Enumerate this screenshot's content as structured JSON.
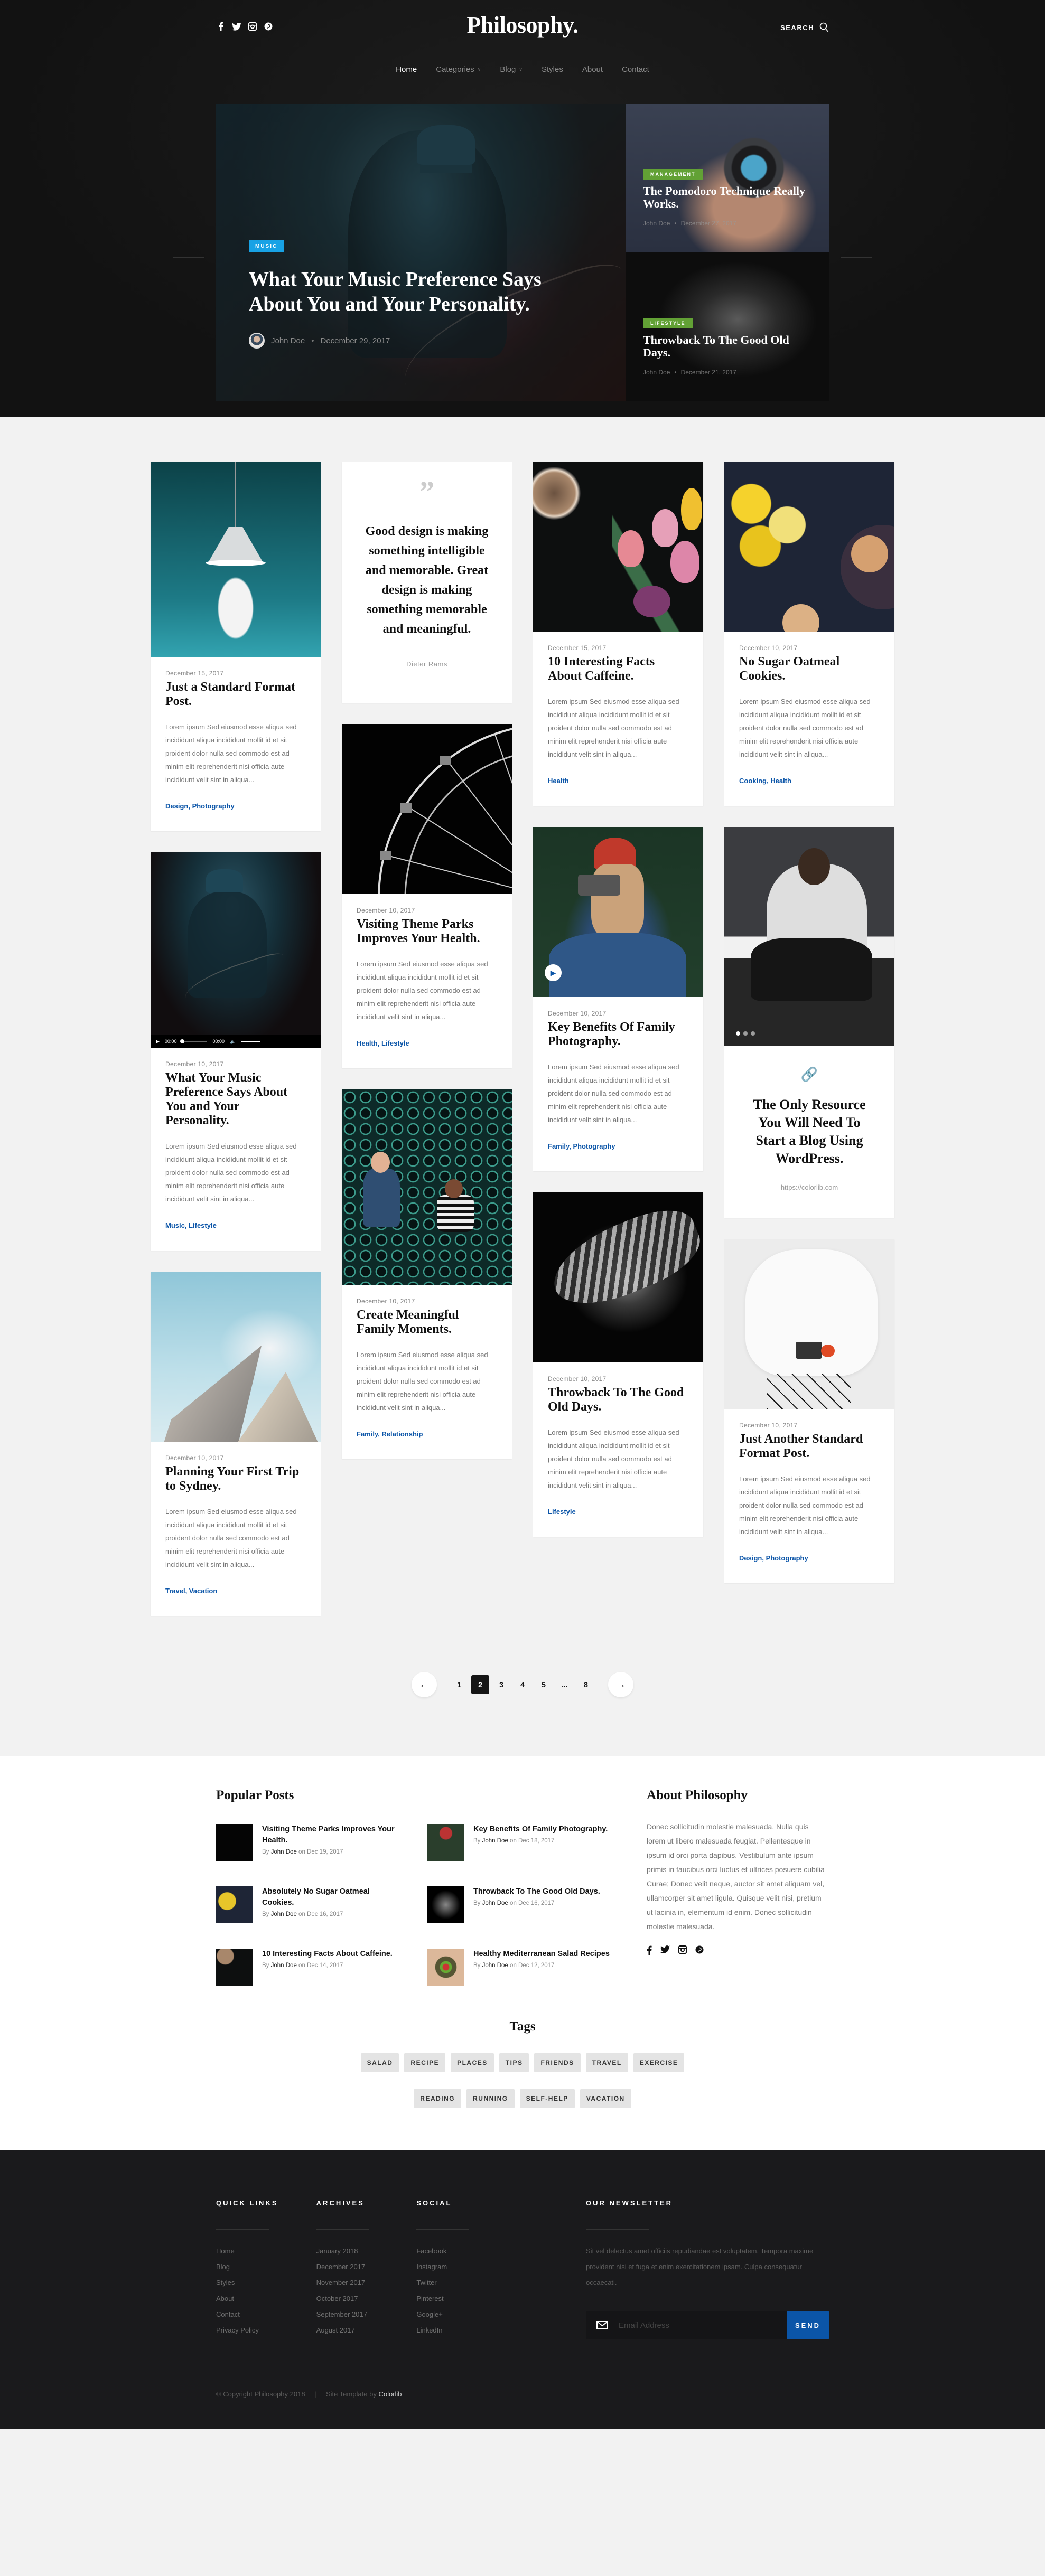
{
  "header": {
    "logo": "Philosophy.",
    "search_label": "SEARCH",
    "social": [
      "facebook-icon",
      "twitter-icon",
      "instagram-icon",
      "pinterest-icon"
    ],
    "nav": [
      {
        "label": "Home",
        "active": true,
        "dropdown": false
      },
      {
        "label": "Categories",
        "active": false,
        "dropdown": true
      },
      {
        "label": "Blog",
        "active": false,
        "dropdown": true
      },
      {
        "label": "Styles",
        "active": false,
        "dropdown": false
      },
      {
        "label": "About",
        "active": false,
        "dropdown": false
      },
      {
        "label": "Contact",
        "active": false,
        "dropdown": false
      }
    ]
  },
  "featured": {
    "main": {
      "category": "Music",
      "category_color": "#18a2e5",
      "title": "What Your Music Preference Says About You and Your Personality.",
      "author": "John Doe",
      "date": "December 29, 2017"
    },
    "side": [
      {
        "category": "Management",
        "category_color": "#62a135",
        "title": "The Pomodoro Technique Really Works.",
        "author": "John Doe",
        "date": "December 27, 2017"
      },
      {
        "category": "Lifestyle",
        "category_color": "#62a135",
        "title": "Throwback To The Good Old Days.",
        "author": "John Doe",
        "date": "December 21, 2017"
      }
    ]
  },
  "excerpt": "Lorem ipsum Sed eiusmod esse aliqua sed incididunt aliqua incididunt mollit id et sit proident dolor nulla sed commodo est ad minim elit reprehenderit nisi officia aute incididunt velit sint in aliqua...",
  "posts": {
    "standard1": {
      "date": "December 15, 2017",
      "title": "Just a Standard Format Post.",
      "cats": "Design, Photography"
    },
    "audio": {
      "date": "December 10, 2017",
      "title": "What Your Music Preference Says About You and Your Personality.",
      "cats": "Music, Lifestyle",
      "time_current": "00:00",
      "time_total": "00:00"
    },
    "sydney": {
      "date": "December 10, 2017",
      "title": "Planning Your First Trip to Sydney.",
      "cats": "Travel, Vacation"
    },
    "quote": {
      "text": "Good design is making something intelligible and memorable. Great design is making something memorable and meaningful.",
      "author": "Dieter Rams"
    },
    "themeparks": {
      "date": "December 10, 2017",
      "title": "Visiting Theme Parks Improves Your Health.",
      "cats": "Health, Lifestyle"
    },
    "family": {
      "date": "December 10, 2017",
      "title": "Create Meaningful Family Moments.",
      "cats": "Family, Relationship"
    },
    "caffeine": {
      "date": "December 15, 2017",
      "title": "10 Interesting Facts About Caffeine.",
      "cats": "Health"
    },
    "photography": {
      "date": "December 10, 2017",
      "title": "Key Benefits Of Family Photography.",
      "cats": "Family, Photography"
    },
    "throwback": {
      "date": "December 10, 2017",
      "title": "Throwback To The Good Old Days.",
      "cats": "Lifestyle"
    },
    "cookies": {
      "date": "December 10, 2017",
      "title": "No Sugar Oatmeal Cookies.",
      "cats": "Cooking, Health"
    },
    "link": {
      "title": "The Only Resource You Will Need To Start a Blog Using WordPress.",
      "url": "https://colorlib.com",
      "slides": 3,
      "active_slide": 1
    },
    "standard2": {
      "date": "December 10, 2017",
      "title": "Just Another Standard Format Post.",
      "cats": "Design, Photography"
    }
  },
  "pagination": {
    "prev": "←",
    "next": "→",
    "pages": [
      "1",
      "2",
      "3",
      "4",
      "5",
      "...",
      "8"
    ],
    "current": "2"
  },
  "popular": {
    "title": "Popular Posts",
    "by": "By",
    "on": "on",
    "items": [
      {
        "title": "Visiting Theme Parks Improves Your Health.",
        "author": "John Doe",
        "date": "Dec 19, 2017"
      },
      {
        "title": "Key Benefits Of Family Photography.",
        "author": "John Doe",
        "date": "Dec 18, 2017"
      },
      {
        "title": "Absolutely No Sugar Oatmeal Cookies.",
        "author": "John Doe",
        "date": "Dec 16, 2017"
      },
      {
        "title": "Throwback To The Good Old Days.",
        "author": "John Doe",
        "date": "Dec 16, 2017"
      },
      {
        "title": "10 Interesting Facts About Caffeine.",
        "author": "John Doe",
        "date": "Dec 14, 2017"
      },
      {
        "title": "Healthy Mediterranean Salad Recipes",
        "author": "John Doe",
        "date": "Dec 12, 2017"
      }
    ]
  },
  "about": {
    "title": "About Philosophy",
    "text": "Donec sollicitudin molestie malesuada. Nulla quis lorem ut libero malesuada feugiat. Pellentesque in ipsum id orci porta dapibus. Vestibulum ante ipsum primis in faucibus orci luctus et ultrices posuere cubilia Curae; Donec velit neque, auctor sit amet aliquam vel, ullamcorper sit amet ligula. Quisque velit nisi, pretium ut lacinia in, elementum id enim. Donec sollicitudin molestie malesuada."
  },
  "tags": {
    "title": "Tags",
    "items": [
      "SALAD",
      "RECIPE",
      "PLACES",
      "TIPS",
      "FRIENDS",
      "TRAVEL",
      "EXERCISE",
      "READING",
      "RUNNING",
      "SELF-HELP",
      "VACATION"
    ]
  },
  "footer": {
    "quick_links": {
      "title": "QUICK LINKS",
      "items": [
        "Home",
        "Blog",
        "Styles",
        "About",
        "Contact",
        "Privacy Policy"
      ]
    },
    "archives": {
      "title": "ARCHIVES",
      "items": [
        "January 2018",
        "December 2017",
        "November 2017",
        "October 2017",
        "September 2017",
        "August 2017"
      ]
    },
    "social": {
      "title": "SOCIAL",
      "items": [
        "Facebook",
        "Instagram",
        "Twitter",
        "Pinterest",
        "Google+",
        "LinkedIn"
      ]
    },
    "newsletter": {
      "title": "OUR NEWSLETTER",
      "text": "Sit vel delectus amet officiis repudiandae est voluptatem. Tempora maxime provident nisi et fuga et enim exercitationem ipsam. Culpa consequatur occaecati.",
      "placeholder": "Email Address",
      "button": "SEND"
    },
    "copyright": "© Copyright Philosophy 2018",
    "template_by": "Site Template by",
    "template_author": "Colorlib"
  }
}
